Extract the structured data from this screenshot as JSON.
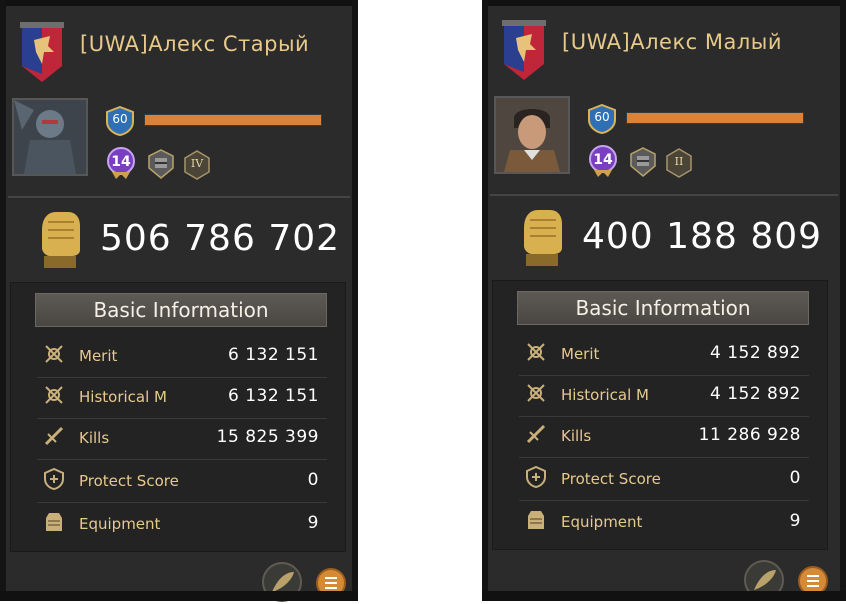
{
  "cards": [
    {
      "player_name": "[UWA]Алекс Старый",
      "level": "60",
      "xp_fraction": 1.0,
      "badge_number": "14",
      "rank_numeral": "IV",
      "power": "506 786 702",
      "section_title": "Basic Information",
      "rows": [
        {
          "label": "Merit",
          "value": "6 132 151",
          "icon": "merit-icon"
        },
        {
          "label": "Historical M",
          "value": "6 132 151",
          "icon": "historical-merit-icon"
        },
        {
          "label": "Kills",
          "value": "15 825 399",
          "icon": "kills-icon"
        },
        {
          "label": "Protect Score",
          "value": "0",
          "icon": "protect-shield-icon"
        },
        {
          "label": "Equipment",
          "value": "9",
          "icon": "equipment-armor-icon"
        }
      ]
    },
    {
      "player_name": "[UWA]Алекс Малый",
      "level": "60",
      "xp_fraction": 1.0,
      "badge_number": "14",
      "rank_numeral": "II",
      "power": "400 188 809",
      "section_title": "Basic Information",
      "rows": [
        {
          "label": "Merit",
          "value": "4 152 892",
          "icon": "merit-icon"
        },
        {
          "label": "Historical M",
          "value": "4 152 892",
          "icon": "historical-merit-icon"
        },
        {
          "label": "Kills",
          "value": "11 286 928",
          "icon": "kills-icon"
        },
        {
          "label": "Protect Score",
          "value": "0",
          "icon": "protect-shield-icon"
        },
        {
          "label": "Equipment",
          "value": "9",
          "icon": "equipment-armor-icon"
        }
      ]
    }
  ],
  "colors": {
    "name_gold": "#e7c98a",
    "label_gold": "#e6c98c",
    "xp_orange": "#d9823a",
    "panel_dark": "#2b2b2b"
  }
}
